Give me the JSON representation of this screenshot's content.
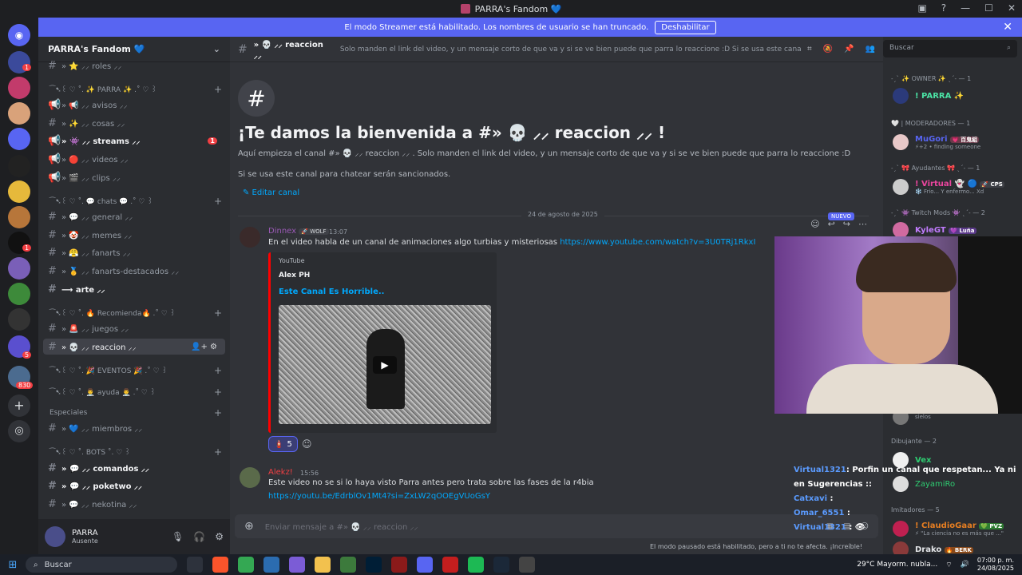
{
  "window": {
    "title": "PARRA's Fandom 💙"
  },
  "banner": {
    "text": "El modo Streamer está habilitado. Los nombres de usuario se han truncado.",
    "button": "Deshabilitar",
    "close": "✕"
  },
  "servers": {
    "badges": [
      "1",
      "1",
      "5",
      "830"
    ]
  },
  "guild": {
    "name": "PARRA's Fandom 💙",
    "chevron": "⌄"
  },
  "channels": {
    "items": [
      {
        "name": "» ⭐ ⸝⸝ roles ⸝⸝"
      },
      {
        "name": "» 📢 ⸝⸝ avisos ⸝⸝"
      },
      {
        "name": "» ✨ ⸝⸝ cosas ⸝⸝"
      },
      {
        "name": "» 👾 ⸝⸝ streams ⸝⸝",
        "badge": "1"
      },
      {
        "name": "» 🔴 ⸝⸝ videos ⸝⸝"
      },
      {
        "name": "» 🎬 ⸝⸝ clips ⸝⸝"
      },
      {
        "name": "» 💬 ⸝⸝ general ⸝⸝"
      },
      {
        "name": "» 🤡 ⸝⸝ memes ⸝⸝"
      },
      {
        "name": "» 😤 ⸝⸝ fanarts ⸝⸝"
      },
      {
        "name": "» 🥇 ⸝⸝ fanarts-destacados ⸝⸝"
      },
      {
        "name": "⟶ arte ⸝⸝"
      },
      {
        "name": "» 🚨 ⸝⸝ juegos ⸝⸝"
      },
      {
        "name": "» 💀 ⸝⸝ reaccion ⸝⸝"
      },
      {
        "name": "» 💙 ⸝⸝ miembros ⸝⸝"
      },
      {
        "name": "» 💬 ⸝⸝ comandos ⸝⸝"
      },
      {
        "name": "» 💬 ⸝⸝ poketwo ⸝⸝"
      },
      {
        "name": "» 💬 ⸝⸝ nekotina ⸝⸝"
      }
    ],
    "categories": [
      "⁀➷꒰ ♡ ˚. ✨ PARRA ✨ .˚ ♡ ꒱",
      "⁀➷꒰ ♡ ˚. 💬 chats 💬 .˚ ♡ ꒱",
      "⁀➷꒰ ♡ ˚. 🔥 Recomienda🔥 .˚ ♡ ꒱",
      "⁀➷꒰ ♡ ˚. 🎉 EVENTOS 🎉 .˚ ♡ ꒱",
      "⁀➷꒰ ♡ ˚. 👨‍⚕️ ayuda 👨‍⚕️ .˚ ♡ ꒱",
      "Especiales",
      "⁀➷꒰ ♡ ˚. BOTS ˚. ♡ ꒱"
    ],
    "active_actions": "👤+ ⚙"
  },
  "user": {
    "name": "PARRA",
    "status": "Ausente"
  },
  "chat": {
    "header_name": "» 💀 ⸝⸝ reaccion ⸝⸝",
    "topic": "Solo manden el link del video, y un mensaje corto de que va y si se ve bien puede que parra lo reaccione :D Si se usa este canal para chatear ser...",
    "welcome_title": "¡Te damos la bienvenida a #» 💀 ⸝⸝ reaccion ⸝⸝ !",
    "welcome_sub": "Aquí empieza el canal #» 💀 ⸝⸝ reaccion ⸝⸝ . Solo manden el link del video, y un mensaje corto de que va y si se ve bien puede que parra lo reaccione :D",
    "welcome_sub2": "Si se usa este canal para chatear serán sancionados.",
    "edit": "✎ Editar canal",
    "date": "24 de agosto de 2025",
    "new_badge": "NUEVO",
    "composer_placeholder": "Enviar mensaje a #» 💀 ⸝⸝ reaccion ⸝⸝",
    "paused": "El modo pausado está habilitado, pero a ti no te afecta. ¡Increíble!"
  },
  "messages": [
    {
      "author": "Dinnex",
      "tag": "🚀 WOLF",
      "time": "13:07",
      "text": "En el video habla de un canal de animaciones algo turbias y misteriosas",
      "link": "https://www.youtube.com/watch?v=3U0TRj1RkxI",
      "embed": {
        "provider": "YouTube",
        "author": "Alex PH",
        "title": "Este Canal Es Horrible.."
      },
      "reaction": {
        "emoji": "🧯",
        "count": "5"
      }
    },
    {
      "author": "Alekz!",
      "time": "15:56",
      "text": "Este video no se si lo haya visto Parra antes pero trata sobre las fases de la r4bia",
      "link": "https://youtu.be/EdrblOv1Mt4?si=ZxLW2qOOEgVUoGsY"
    }
  ],
  "members": {
    "search": "Buscar",
    "groups": [
      {
        "label": "˗ˏˋ ✨ OWNER ✨ ˎˊ˗ — 1"
      },
      {
        "label": "🤍 | MODERADORES — 1"
      },
      {
        "label": "˗ˏˋ 🎀 Ayudantes 🎀 ˎˊ˗ — 1"
      },
      {
        "label": "˗ˏˋ 👾 Twitch Mods 👾 ˎˊ˗ — 2"
      },
      {
        "label": "Dibujante — 2"
      },
      {
        "label": "Imitadores — 5"
      }
    ],
    "list": [
      {
        "name": "! PARRA ✨",
        "sub": ""
      },
      {
        "name": "MuGori",
        "tag": "💗 百鬼組",
        "sub": "⚡+2 • finding someone"
      },
      {
        "name": "! Virtual 👻 🔵",
        "tag": "🚀 CPS",
        "sub": "❄️ Frío... Y enfermo... Xd"
      },
      {
        "name": "KyleGT",
        "tag": "💜 Luña",
        "sub": ""
      },
      {
        "name": "Vex",
        "sub": ""
      },
      {
        "name": "ZayamiRo",
        "sub": ""
      },
      {
        "name": "! ClaudioGaar",
        "tag": "💚 PVZ",
        "sub": "⚡ \"La ciencia no es más que ...\""
      },
      {
        "name": "Drako",
        "tag": "🔥 BERK",
        "sub": ""
      }
    ],
    "partial": {
      "name": "sielos"
    }
  },
  "overlay_chat": [
    {
      "user": "Virtual1321",
      "text": ": Porfin un canal que respetan... Ya ni en Sugerencias ::"
    },
    {
      "user": "Catxavi",
      "text": ":"
    },
    {
      "user": "Omar_6551",
      "text": ":"
    },
    {
      "user": "Virtual1321",
      "text": ": 👁"
    }
  ],
  "taskbar": {
    "search": "Buscar",
    "weather": "29°C  Mayorm. nubla...",
    "time": "07:00 p. m.",
    "date": "24/08/2025"
  },
  "colors": {
    "accent": "#5865f2",
    "link": "#00a8fc",
    "mention_red": "#f23f43"
  }
}
